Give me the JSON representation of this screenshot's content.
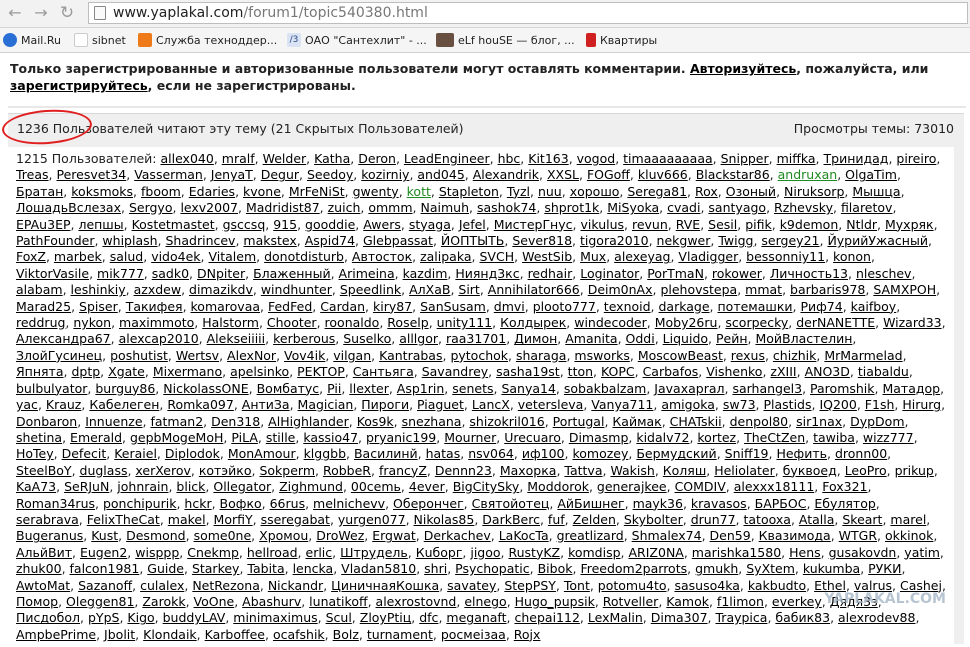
{
  "browser": {
    "url_host": "www.yaplakal.com",
    "url_path": "/forum1/topic540380.html",
    "bookmarks": [
      "Mail.Ru",
      "sibnet",
      "Служба техноддер...",
      "ОАО \"Сантехлит\" - ...",
      "eLf houSE — блог, ...",
      "Квартиры"
    ]
  },
  "notice": {
    "part1": "Только зарегистрированные и авторизованные пользователи могут оставлять комментарии. ",
    "login_link": "Авторизуйтесь",
    "part2": ", пожалуйста, или ",
    "register_link": "зарегистрируйтесь",
    "part3": ", если не зарегистрированы."
  },
  "stats": {
    "readers": "1236 Пользователей читают эту тему (21 Скрытых Пользователей)",
    "views": "Просмотры темы: 73010",
    "members_prefix": "1215 Пользователей: "
  },
  "users": [
    "allex040",
    "mralf",
    "Welder",
    "Katha",
    "Deron",
    "LeadEngineer",
    "hbc",
    "Kit163",
    "vogod",
    "timaaaaaaaaa",
    "Snipper",
    "miffka",
    "Тринидад",
    "pireiro",
    "Treas",
    "Peresvet34",
    "Vasserman",
    "JenyaT",
    "Degur",
    "Seedoy",
    "kozirniy",
    "and045",
    "Alexandrik",
    "XXSL",
    "FOGoff",
    "kluv666",
    "Blackstar86",
    "andruxan",
    "OlgaTim",
    "Братан",
    "koksmoks",
    "fboom",
    "Edaries",
    "kvone",
    "MrFeNiSt",
    "gwenty",
    "kott",
    "Stapleton",
    "Tyzl",
    "nuu",
    "хорошо",
    "Serega81",
    "Rox",
    "Озоный",
    "Niruksorp",
    "Мышца",
    "ЛошадьВслезах",
    "Sergyo",
    "lexv2007",
    "Madridist87",
    "zuich",
    "ommm",
    "Naimuh",
    "sashok74",
    "shprot1k",
    "MiSyoka",
    "cvadi",
    "santyago",
    "Rzhevsky",
    "filaretov",
    "EPAu3EP",
    "лепшы",
    "Kostetmastet",
    "gsccsq",
    "915",
    "gooddie",
    "Awers",
    "styaga",
    "Jefel",
    "МистерГнус",
    "vikulus",
    "revun",
    "RVE",
    "Sesil",
    "pifik",
    "k9demon",
    "Ntldr",
    "Мухряк",
    "PathFounder",
    "whiplash",
    "Shadrincev",
    "makstex",
    "Aspid74",
    "Glebpassat",
    "ЙОПТЫТЬ",
    "Sever818",
    "tigora2010",
    "nekgwer",
    "Twigg",
    "sergey21",
    "ЙурийУжасный",
    "FoxZ",
    "marbek",
    "salud",
    "vido4ek",
    "Vitalem",
    "donotdisturb",
    "Автосток",
    "zalipaka",
    "SVCH",
    "WestSib",
    "Mux",
    "alexeyag",
    "Vladigger",
    "bessonniy11",
    "konon",
    "ViktorVasile",
    "mik777",
    "sadk0",
    "DNpiter",
    "Блаженный",
    "Arimeina",
    "kazdim",
    "Ниянд3кс",
    "redhair",
    "Loginator",
    "PorTmaN",
    "rokower",
    "Личность13",
    "nleschev",
    "alabam",
    "leshinkiy",
    "azxdew",
    "dimazikdv",
    "windhunter",
    "Speedlink",
    "AлXaB",
    "Sirt",
    "Annihilator666",
    "Deim0nAx",
    "plehovstepa",
    "mmat",
    "barbaris978",
    "SAMXPOH",
    "Marad25",
    "Spiser",
    "Такифея",
    "komarovaa",
    "FedFed",
    "Cardan",
    "kiry87",
    "SanSusam",
    "dmvi",
    "plooto777",
    "texnoid",
    "darkage",
    "потемашки",
    "Риф74",
    "kaifboy",
    "reddrug",
    "nykon",
    "maximmoto",
    "Halstorm",
    "Chooter",
    "roonaldo",
    "Roselp",
    "unity111",
    "Колдырек",
    "windecoder",
    "Moby26ru",
    "scorpecky",
    "derNANETTE",
    "Wizard33",
    "Александра67",
    "alexcap2010",
    "Alekseiiiii",
    "kerberous",
    "Suselko",
    "alllgor",
    "raa31701",
    "Димон",
    "Amanita",
    "Oddi",
    "Liquido",
    "Рейн",
    "МойВластелин",
    "ЗлойГусинец",
    "poshutist",
    "Wertsv",
    "AlexNor",
    "Vov4ik",
    "vilgan",
    "Kantrabas",
    "pytochok",
    "sharaga",
    "msworks",
    "MoscowBeast",
    "rexus",
    "chizhik",
    "MrMarmelad",
    "Япнята",
    "dptp",
    "Xgate",
    "Mixermano",
    "apelsinko",
    "PEKTOP",
    "Сантьяга",
    "Savandrey",
    "sasha19st",
    "tton",
    "KOPC",
    "Carbafos",
    "Vishenko",
    "zXIII",
    "ANO3D",
    "tiabaldu",
    "bulbulyator",
    "burguy86",
    "NickolassONE",
    "Вомбатус",
    "Pii",
    "llexter",
    "Asp1rin",
    "senets",
    "Sanya14",
    "sobakbalzam",
    "Javaxapraл",
    "sarhangel3",
    "Paromshik",
    "Матадор",
    "yac",
    "Krauz",
    "Кабелеген",
    "Romka097",
    "АнтиЗа",
    "Magician",
    "Пироги",
    "Piaguet",
    "LancX",
    "vetersleva",
    "Vanya711",
    "amigoka",
    "sw73",
    "Plastids",
    "IQ200",
    "F1sh",
    "Hirurg",
    "Donbaron",
    "Innuenze",
    "fatman2",
    "Den318",
    "AlHighlander",
    "Kos9k",
    "snezhana",
    "shizokril016",
    "Portugal",
    "Каймак",
    "CHATskii",
    "denpol80",
    "sir1nax",
    "DypDom",
    "shetina",
    "Emerald",
    "gepbMogeMoH",
    "PiLA",
    "stille",
    "kassio47",
    "pryanic199",
    "Mourner",
    "Urecuaro",
    "Dimasmp",
    "kidalv72",
    "kortez",
    "TheCtZen",
    "tawiba",
    "wizz777",
    "HoTey",
    "Defecit",
    "Keraiel",
    "Diplodok",
    "MonAmour",
    "klggbb",
    "Василинй",
    "hatas",
    "nsv064",
    "иф100",
    "komozey",
    "Бермудский",
    "Sniff19",
    "Нефить",
    "dronn00",
    "SteelBoY",
    "duglass",
    "xerXerov",
    "котэйко",
    "Sokperm",
    "RobbeR",
    "francyZ",
    "Dennn23",
    "Махорка",
    "Tattva",
    "Wakish",
    "Коляш",
    "Heliolater",
    "буквоед",
    "LeoPro",
    "prikup",
    "KaA73",
    "SeRJuN",
    "johnrain",
    "blick",
    "Ollegator",
    "Zighmund",
    "00сemь",
    "4ever",
    "BigCitySky",
    "Moddorok",
    "generajkee",
    "COMDIV",
    "alexxx18111",
    "Fox321",
    "Roman34rus",
    "ponchipurik",
    "hckr",
    "Вофко",
    "66rus",
    "melnichevv",
    "Оберончег",
    "Святойотец",
    "АйБишнег",
    "mayk36",
    "kravasos",
    "БАРБОС",
    "Ебулятор",
    "serabrava",
    "FelixTheCat",
    "makel",
    "MorfiY",
    "sseregabat",
    "yurgen077",
    "Nikolas85",
    "DarkBerc",
    "fuf",
    "Zelden",
    "Skybolter",
    "drun77",
    "tatooxa",
    "Atalla",
    "Skeart",
    "marel",
    "Bugeranus",
    "Kust",
    "Desmond",
    "some0ne",
    "Хромоu",
    "DroWez",
    "Ergwat",
    "Derkachev",
    "LaKocTa",
    "greatlizard",
    "Shmalex74",
    "Den59",
    "Квазимода",
    "WTGR",
    "okkinok",
    "АльйВит",
    "Eugen2",
    "wisppp",
    "Cnekmp",
    "hellroad",
    "erlic",
    "Штрудель",
    "Кuборг",
    "jigoo",
    "RustyKZ",
    "komdisp",
    "ARIZ0NA",
    "marishka1580",
    "Hens",
    "gusakovdn",
    "yatim",
    "zhuk00",
    "falcon1981",
    "Guide",
    "Starkey",
    "Tabita",
    "lencka",
    "Vladan5810",
    "shri",
    "Psychopatic",
    "Bibok",
    "Freedom2parrots",
    "gmukh",
    "SyXtem",
    "kukumba",
    "РУКИ",
    "AwtoMat",
    "Sazanoff",
    "culalex",
    "NetRezona",
    "Nickandr",
    "ЦиничнаяКошка",
    "savatey",
    "StepPSY",
    "Tont",
    "potomu4to",
    "sasuso4ka",
    "kakbudto",
    "Ethel",
    "valrus",
    "Cashej",
    "Помор",
    "Oleggen81",
    "Zarokk",
    "VoOne",
    "Abashurv",
    "lunatikoff",
    "alexrostovnd",
    "elnego",
    "Hugo_pupsik",
    "Rotveller",
    "Kamok",
    "f1limon",
    "everkey",
    "Дядя3з",
    "Писдобол",
    "pYpS",
    "Kigo",
    "buddyLAV",
    "minimaximus",
    "Scul",
    "ZloyPtiц",
    "dfc",
    "meganaft",
    "chepai112",
    "LexMalin",
    "Dima307",
    "Traypica",
    "бабик83",
    "alexrodev88",
    "AmpbePrime",
    "Jbolit",
    "Klondaik",
    "Karboffee",
    "ocafshik",
    "Bolz",
    "turnament",
    "росмеiзаа",
    "Rojx"
  ],
  "green_users": [
    "andruxan",
    "kott"
  ],
  "watermark": "YAPLAKAL.COM"
}
